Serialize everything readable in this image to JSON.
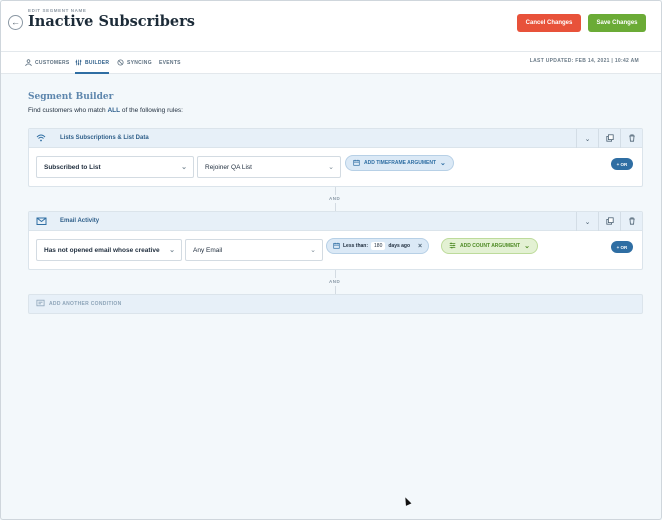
{
  "header": {
    "edit_label": "EDIT SEGMENT NAME",
    "title": "Inactive Subscribers",
    "cancel_label": "Cancel Changes",
    "save_label": "Save Changes",
    "back_icon": "arrow-left-circle-icon",
    "colors": {
      "cancel": "#e8523a",
      "save": "#6bab36",
      "accent": "#2f6ea3"
    }
  },
  "tabs": [
    {
      "label": "CUSTOMERS",
      "icon": "user-icon",
      "active": false
    },
    {
      "label": "BUILDER",
      "icon": "sliders-icon",
      "active": true
    },
    {
      "label": "SYNCING",
      "icon": "sync-icon",
      "active": false
    },
    {
      "label": "EVENTS",
      "icon": "",
      "active": false
    }
  ],
  "last_updated": "LAST UPDATED: FEB 14, 2021 | 10:42 AM",
  "builder": {
    "title": "Segment Builder",
    "subtitle_before": "Find customers who match ",
    "subtitle_match": "ALL",
    "subtitle_after": " of the following rules:"
  },
  "conditions": [
    {
      "title": "Lists Subscriptions & List Data",
      "icon": "wifi-icon",
      "rule_select": "Subscribed to List",
      "value_select": "Rejoiner QA List",
      "timeframe_label": "ADD TIMEFRAME ARGUMENT",
      "or_label": "+ OR"
    },
    {
      "title": "Email Activity",
      "icon": "email-icon",
      "rule_select": "Has not opened email whose creative",
      "value_select": "Any Email",
      "less_than_label": "Less than:",
      "less_than_value": "180",
      "days_label": "days ago",
      "count_label": "ADD COUNT ARGUMENT",
      "or_label": "+ OR"
    }
  ],
  "and_label": "AND",
  "add_condition_label": "ADD ANOTHER CONDITION"
}
